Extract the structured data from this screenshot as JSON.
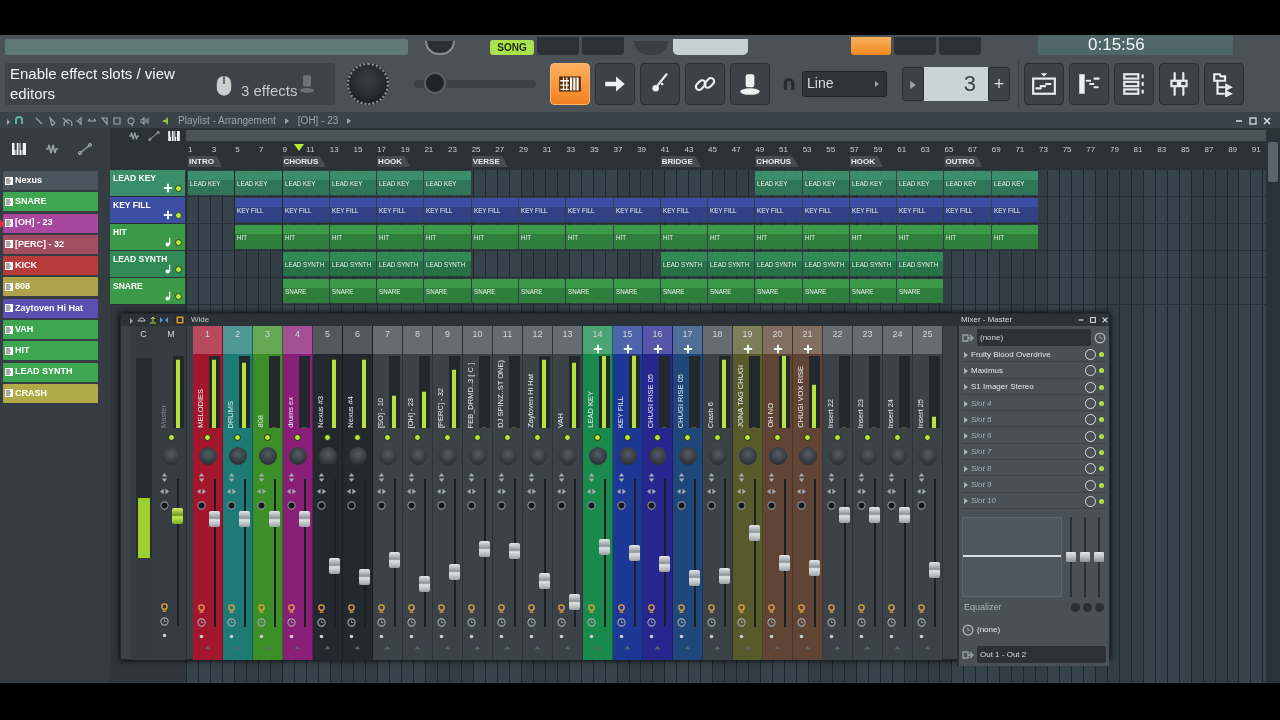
{
  "top_bar": {
    "song_button": "SONG",
    "song_selected": true,
    "time": "0:15:56"
  },
  "hint_panel": {
    "text": "Enable effect slots / view editors",
    "effects": "3 effects"
  },
  "toolbar": {
    "slider": {
      "level": 0.1
    },
    "tools": [
      {
        "kind": "pianoroll",
        "selected": true
      },
      {
        "kind": "arrow",
        "selected": false
      },
      {
        "kind": "brush",
        "selected": false
      },
      {
        "kind": "link",
        "selected": false
      },
      {
        "kind": "stamp",
        "selected": false
      }
    ],
    "snap": "Line",
    "step": "3",
    "plus": "+",
    "windows": [
      {
        "kind": "playlist"
      },
      {
        "kind": "steps"
      },
      {
        "kind": "rack"
      },
      {
        "kind": "mixer"
      },
      {
        "kind": "browser"
      }
    ]
  },
  "playlist": {
    "title": "Playlist - Arrangement",
    "crumb": "[OH] - 23",
    "picker": [
      {
        "label": "Nexus",
        "color": "#4b555e",
        "selected": false
      },
      {
        "label": "SNARE",
        "color": "#3ea650",
        "selected": false
      },
      {
        "label": "[OH] - 23",
        "color": "#a8479f",
        "selected": true
      },
      {
        "label": "[PERC] - 32",
        "color": "#a24d60",
        "selected": false
      },
      {
        "label": "KICK",
        "color": "#b83b3b",
        "selected": false
      },
      {
        "label": "808",
        "color": "#aea34a",
        "selected": false
      },
      {
        "label": "Zaytoven Hi Hat",
        "color": "#5b4fb3",
        "selected": false
      },
      {
        "label": "VAH",
        "color": "#3ea650",
        "selected": false
      },
      {
        "label": "HIT",
        "color": "#3ea650",
        "selected": false
      },
      {
        "label": "LEAD SYNTH",
        "color": "#3ea650",
        "selected": false
      },
      {
        "label": "CRASH",
        "color": "#b0aa48",
        "selected": false
      }
    ],
    "ruler": [
      "1",
      "3",
      "5",
      "7",
      "9",
      "11",
      "13",
      "15",
      "17",
      "19",
      "21",
      "23",
      "25",
      "27",
      "29",
      "31",
      "33",
      "35",
      "37",
      "39",
      "41",
      "43",
      "45",
      "47",
      "49",
      "51",
      "53",
      "55",
      "57",
      "59",
      "61",
      "63",
      "65",
      "67",
      "69",
      "71",
      "73",
      "75",
      "77",
      "79",
      "81",
      "83",
      "85",
      "87",
      "89",
      "91"
    ],
    "markers": [
      {
        "kind": "marker",
        "label": "INTRO"
      },
      {
        "kind": "empty"
      },
      {
        "kind": "marker",
        "label": "CHORUS"
      },
      {
        "kind": "empty"
      },
      {
        "kind": "marker",
        "label": "HOOK"
      },
      {
        "kind": "empty"
      },
      {
        "kind": "marker",
        "label": "VERSE"
      },
      {
        "kind": "empty"
      },
      {
        "kind": "empty"
      },
      {
        "kind": "empty"
      },
      {
        "kind": "marker",
        "label": "BRIDGE"
      },
      {
        "kind": "empty"
      },
      {
        "kind": "marker",
        "label": "CHORUS"
      },
      {
        "kind": "empty"
      },
      {
        "kind": "marker",
        "label": "HOOK"
      },
      {
        "kind": "empty"
      },
      {
        "kind": "marker",
        "label": "OUTRO"
      }
    ],
    "tracks": [
      {
        "name": "LEAD KEY",
        "kind": "routed",
        "color": "#3a8f6a",
        "cells": [
          {
            "kind": "clip",
            "label": "LEAD KEY"
          },
          {
            "kind": "clip",
            "label": "LEAD KEY"
          },
          {
            "kind": "clip",
            "label": "LEAD KEY"
          },
          {
            "kind": "clip",
            "label": "LEAD KEY"
          },
          {
            "kind": "clip",
            "label": "LEAD KEY"
          },
          {
            "kind": "clip",
            "label": "LEAD KEY"
          },
          {
            "kind": "empty"
          },
          {
            "kind": "empty"
          },
          {
            "kind": "empty"
          },
          {
            "kind": "empty"
          },
          {
            "kind": "empty"
          },
          {
            "kind": "empty"
          },
          {
            "kind": "clip",
            "label": "LEAD KEY"
          },
          {
            "kind": "clip",
            "label": "LEAD KEY"
          },
          {
            "kind": "clip",
            "label": "LEAD KEY"
          },
          {
            "kind": "clip",
            "label": "LEAD KEY"
          },
          {
            "kind": "clip",
            "label": "LEAD KEY"
          },
          {
            "kind": "clip",
            "label": "LEAD KEY"
          }
        ]
      },
      {
        "name": "KEY FILL",
        "kind": "routed",
        "color": "#3d4fa2",
        "cells": [
          {
            "kind": "empty"
          },
          {
            "kind": "clip",
            "label": "KEY FILL"
          },
          {
            "kind": "clip",
            "label": "KEY FILL"
          },
          {
            "kind": "clip",
            "label": "KEY FILL"
          },
          {
            "kind": "clip",
            "label": "KEY FILL"
          },
          {
            "kind": "clip",
            "label": "KEY FILL"
          },
          {
            "kind": "clip",
            "label": "KEY FILL"
          },
          {
            "kind": "clip",
            "label": "KEY FILL"
          },
          {
            "kind": "clip",
            "label": "KEY FILL"
          },
          {
            "kind": "clip",
            "label": "KEY FILL"
          },
          {
            "kind": "clip",
            "label": "KEY FILL"
          },
          {
            "kind": "clip",
            "label": "KEY FILL"
          },
          {
            "kind": "clip",
            "label": "KEY FILL"
          },
          {
            "kind": "clip",
            "label": "KEY FILL"
          },
          {
            "kind": "clip",
            "label": "KEY FILL"
          },
          {
            "kind": "clip",
            "label": "KEY FILL"
          },
          {
            "kind": "clip",
            "label": "KEY FILL"
          },
          {
            "kind": "clip",
            "label": "KEY FILL"
          }
        ]
      },
      {
        "name": "HIT",
        "kind": "note",
        "color": "#3a9a48",
        "cells": [
          {
            "kind": "empty"
          },
          {
            "kind": "clip",
            "label": "HIT"
          },
          {
            "kind": "clip",
            "label": "HIT"
          },
          {
            "kind": "clip",
            "label": "HIT"
          },
          {
            "kind": "clip",
            "label": "HIT"
          },
          {
            "kind": "clip",
            "label": "HIT"
          },
          {
            "kind": "clip",
            "label": "HIT"
          },
          {
            "kind": "clip",
            "label": "HIT"
          },
          {
            "kind": "clip",
            "label": "HIT"
          },
          {
            "kind": "clip",
            "label": "HIT"
          },
          {
            "kind": "clip",
            "label": "HIT"
          },
          {
            "kind": "clip",
            "label": "HIT"
          },
          {
            "kind": "clip",
            "label": "HIT"
          },
          {
            "kind": "clip",
            "label": "HIT"
          },
          {
            "kind": "clip",
            "label": "HIT"
          },
          {
            "kind": "clip",
            "label": "HIT"
          },
          {
            "kind": "clip",
            "label": "HIT"
          },
          {
            "kind": "clip",
            "label": "HIT"
          }
        ]
      },
      {
        "name": "LEAD SYNTH",
        "kind": "note",
        "color": "#2f8a55",
        "cells": [
          {
            "kind": "empty"
          },
          {
            "kind": "empty"
          },
          {
            "kind": "clip",
            "label": "LEAD SYNTH"
          },
          {
            "kind": "clip",
            "label": "LEAD SYNTH"
          },
          {
            "kind": "clip",
            "label": "LEAD SYNTH"
          },
          {
            "kind": "clip",
            "label": "LEAD SYNTH"
          },
          {
            "kind": "empty"
          },
          {
            "kind": "empty"
          },
          {
            "kind": "empty"
          },
          {
            "kind": "empty"
          },
          {
            "kind": "clip",
            "label": "LEAD SYNTH"
          },
          {
            "kind": "clip",
            "label": "LEAD SYNTH"
          },
          {
            "kind": "clip",
            "label": "LEAD SYNTH"
          },
          {
            "kind": "clip",
            "label": "LEAD SYNTH"
          },
          {
            "kind": "clip",
            "label": "LEAD SYNTH"
          },
          {
            "kind": "clip",
            "label": "LEAD SYNTH"
          }
        ]
      },
      {
        "name": "SNARE",
        "kind": "note",
        "color": "#3a9a48",
        "cells": [
          {
            "kind": "empty"
          },
          {
            "kind": "empty"
          },
          {
            "kind": "clip",
            "label": "SNARE"
          },
          {
            "kind": "clip",
            "label": "SNARE"
          },
          {
            "kind": "clip",
            "label": "SNARE"
          },
          {
            "kind": "clip",
            "label": "SNARE"
          },
          {
            "kind": "clip",
            "label": "SNARE"
          },
          {
            "kind": "clip",
            "label": "SNARE"
          },
          {
            "kind": "clip",
            "label": "SNARE"
          },
          {
            "kind": "clip",
            "label": "SNARE"
          },
          {
            "kind": "clip",
            "label": "SNARE"
          },
          {
            "kind": "clip",
            "label": "SNARE"
          },
          {
            "kind": "clip",
            "label": "SNARE"
          },
          {
            "kind": "clip",
            "label": "SNARE"
          },
          {
            "kind": "clip",
            "label": "SNARE"
          },
          {
            "kind": "clip",
            "label": "SNARE"
          }
        ]
      }
    ]
  },
  "mixer": {
    "mode": "Wide",
    "master": {
      "current": "C",
      "label": "M",
      "name": "Master",
      "peak": {
        "level": 0.3
      },
      "meter": {
        "level": 0.95
      },
      "fader": {
        "level": 0.78
      }
    },
    "strips": [
      {
        "number": "1",
        "name": "MELODIES",
        "color": "#a3172e",
        "linked": false,
        "meter": {
          "level": 0.95
        },
        "fader": {
          "level": 0.76
        }
      },
      {
        "number": "2",
        "name": "DRUMS",
        "color": "#1e7a76",
        "linked": false,
        "meter": {
          "level": 0.9
        },
        "fader": {
          "level": 0.76
        }
      },
      {
        "number": "3",
        "name": "808",
        "color": "#3c8e26",
        "linked": false,
        "meter": {
          "level": 0
        },
        "fader": {
          "level": 0.76
        }
      },
      {
        "number": "4",
        "name": "drums ex",
        "color": "#8a1f78",
        "linked": false,
        "meter": {
          "level": 0
        },
        "fader": {
          "level": 0.76
        }
      },
      {
        "number": "5",
        "name": "Nexus #3",
        "color": "#23292e",
        "linked": false,
        "meter": {
          "level": 0.95
        },
        "fader": {
          "level": 0.4
        }
      },
      {
        "number": "6",
        "name": "Nexus #4",
        "color": "#23292e",
        "linked": false,
        "meter": {
          "level": 0.95
        },
        "fader": {
          "level": 0.32
        }
      },
      {
        "number": "7",
        "name": "[SO] - 10",
        "color": "#3b4349",
        "linked": false,
        "meter": {
          "level": 0.45
        },
        "fader": {
          "level": 0.45
        }
      },
      {
        "number": "8",
        "name": "[OH] - 23",
        "color": "#3b4349",
        "linked": false,
        "meter": {
          "level": 0.5
        },
        "fader": {
          "level": 0.27
        }
      },
      {
        "number": "9",
        "name": "[PERC] - 32",
        "color": "#3b4349",
        "linked": false,
        "meter": {
          "level": 0.8
        },
        "fader": {
          "level": 0.36
        }
      },
      {
        "number": "10",
        "name": "FEB_DRMD..3 [ C ]",
        "color": "#3b4349",
        "linked": false,
        "meter": {
          "level": 0
        },
        "fader": {
          "level": 0.53
        }
      },
      {
        "number": "11",
        "name": "DJ SPINZ..ST ONE)",
        "color": "#3b4349",
        "linked": false,
        "meter": {
          "level": 0
        },
        "fader": {
          "level": 0.52
        }
      },
      {
        "number": "12",
        "name": "Zaytoven Hi Hat",
        "color": "#3b4349",
        "linked": false,
        "meter": {
          "level": 0.95
        },
        "fader": {
          "level": 0.29
        }
      },
      {
        "number": "13",
        "name": "VAH",
        "color": "#3b4349",
        "linked": false,
        "meter": {
          "level": 0.9
        },
        "fader": {
          "level": 0.13
        }
      },
      {
        "number": "14",
        "name": "LEAD KEY",
        "color": "#1a8a4c",
        "linked": true,
        "meter": {
          "level": 1
        },
        "fader": {
          "level": 0.55
        }
      },
      {
        "number": "15",
        "name": "KEY FILL",
        "color": "#1c3894",
        "linked": true,
        "meter": {
          "level": 1
        },
        "fader": {
          "level": 0.5
        }
      },
      {
        "number": "16",
        "name": "CHUGI RISE 05",
        "color": "#27268f",
        "linked": true,
        "meter": {
          "level": 0
        },
        "fader": {
          "level": 0.42
        }
      },
      {
        "number": "17",
        "name": "CHUGI RISE 05",
        "color": "#1f477a",
        "linked": true,
        "meter": {
          "level": 0
        },
        "fader": {
          "level": 0.31
        }
      },
      {
        "number": "18",
        "name": "Crash 6",
        "color": "#3b4349",
        "linked": false,
        "meter": {
          "level": 0.95
        },
        "fader": {
          "level": 0.33
        }
      },
      {
        "number": "19",
        "name": "JONA TAG CHUGI",
        "color": "#575b2c",
        "linked": true,
        "meter": {
          "level": 0
        },
        "fader": {
          "level": 0.65
        }
      },
      {
        "number": "20",
        "name": "OH NO",
        "color": "#604536",
        "linked": true,
        "meter": {
          "level": 1
        },
        "fader": {
          "level": 0.43
        }
      },
      {
        "number": "21",
        "name": "CHUGI VOX RISE",
        "color": "#604536",
        "linked": true,
        "meter": {
          "level": 0.6
        },
        "fader": {
          "level": 0.39
        }
      },
      {
        "number": "22",
        "name": "Insert 22",
        "color": "#3b4349",
        "linked": false,
        "meter": {
          "level": 0
        },
        "fader": {
          "level": 0.79
        }
      },
      {
        "number": "23",
        "name": "Insert 23",
        "color": "#3b4349",
        "linked": false,
        "meter": {
          "level": 0
        },
        "fader": {
          "level": 0.79
        }
      },
      {
        "number": "24",
        "name": "Insert 24",
        "color": "#3b4349",
        "linked": false,
        "meter": {
          "level": 0
        },
        "fader": {
          "level": 0.79
        }
      },
      {
        "number": "25",
        "name": "Insert 25",
        "color": "#3b4349",
        "linked": false,
        "meter": {
          "level": 0.15
        },
        "fader": {
          "level": 0.37
        }
      }
    ],
    "panel": {
      "title": "Mixer - Master",
      "input": "(none)",
      "slots": [
        {
          "name": "Fruity Blood Overdrive",
          "enabled": true
        },
        {
          "name": "Maximus",
          "enabled": true
        },
        {
          "name": "S1 Imager Stereo",
          "enabled": true
        },
        {
          "name": "Slot 4",
          "enabled": false
        },
        {
          "name": "Slot 5",
          "enabled": false
        },
        {
          "name": "Slot 6",
          "enabled": false
        },
        {
          "name": "Slot 7",
          "enabled": false
        },
        {
          "name": "Slot 8",
          "enabled": false
        },
        {
          "name": "Slot 9",
          "enabled": false
        },
        {
          "name": "Slot 10",
          "enabled": false
        }
      ],
      "eq": {
        "label": "Equalizer",
        "bands": [
          {
            "level": 0.5
          },
          {
            "level": 0.5
          },
          {
            "level": 0.5
          }
        ]
      },
      "sidechain": "(none)",
      "output": "Out 1 - Out 2"
    }
  }
}
